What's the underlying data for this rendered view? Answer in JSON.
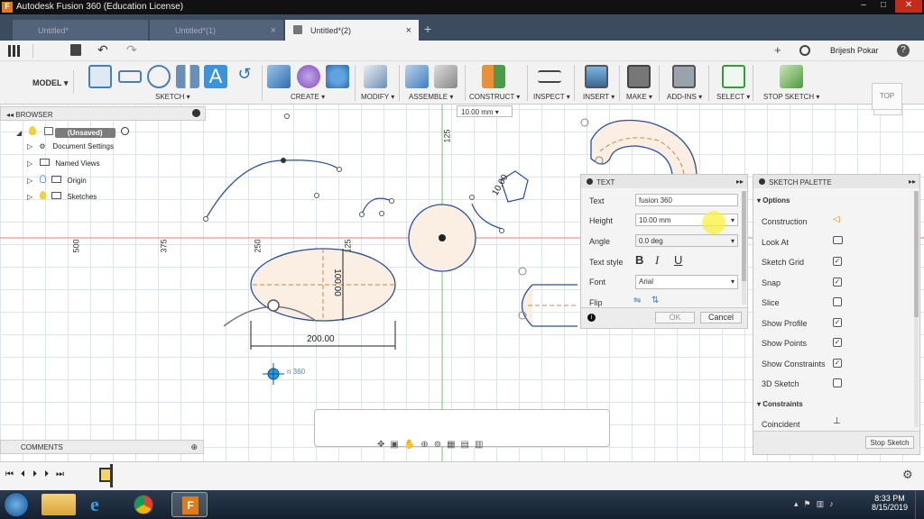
{
  "window": {
    "title": "Autodesk Fusion 360 (Education License)",
    "min": "–",
    "max": "□",
    "close": "✕"
  },
  "tabs": [
    {
      "label": "Untitled*"
    },
    {
      "label": "Untitled*(1)"
    },
    {
      "label": "Untitled*(2)"
    }
  ],
  "tab_close": "×",
  "tab_add": "+",
  "user": {
    "name": "Brijesh Pokar",
    "help": "?"
  },
  "workspace": "MODEL",
  "ribbon": {
    "sketch": "SKETCH",
    "create": "CREATE",
    "modify": "MODIFY",
    "assemble": "ASSEMBLE",
    "construct": "CONSTRUCT",
    "inspect": "INSPECT",
    "insert": "INSERT",
    "make": "MAKE",
    "addins": "ADD-INS",
    "select": "SELECT",
    "stop": "STOP SKETCH"
  },
  "viewcube": {
    "label": "TOP"
  },
  "browser": {
    "title": "BROWSER",
    "root": "(Unsaved)",
    "items": [
      "Document Settings",
      "Named Views",
      "Origin",
      "Sketches"
    ]
  },
  "comments": {
    "title": "COMMENTS"
  },
  "height_input": "10.00 mm",
  "ruler": {
    "h": [
      "500",
      "375",
      "250",
      "125"
    ],
    "v": "125"
  },
  "dims": {
    "width": "200.00",
    "height": "100.00",
    "angled": "10.00",
    "text_preview": "n 360"
  },
  "text_dialog": {
    "title": "TEXT",
    "text_label": "Text",
    "text_value": "fusion 360",
    "height_label": "Height",
    "height_value": "10.00 mm",
    "angle_label": "Angle",
    "angle_value": "0.0 deg",
    "style_label": "Text style",
    "bold": "B",
    "italic": "I",
    "underline": "U",
    "font_label": "Font",
    "font_value": "Arial",
    "flip_label": "Flip",
    "ok": "OK",
    "cancel": "Cancel"
  },
  "palette": {
    "title": "SKETCH PALETTE",
    "options": "Options",
    "rows": [
      {
        "label": "Construction"
      },
      {
        "label": "Look At"
      },
      {
        "label": "Sketch Grid",
        "checked": true
      },
      {
        "label": "Snap",
        "checked": true
      },
      {
        "label": "Slice",
        "checked": false
      },
      {
        "label": "Show Profile",
        "checked": true
      },
      {
        "label": "Show Points",
        "checked": true
      },
      {
        "label": "Show Constraints",
        "checked": true
      },
      {
        "label": "3D Sketch",
        "checked": false
      }
    ],
    "constraints": "Constraints",
    "coincident": "Coincident",
    "stop": "Stop Sketch"
  },
  "clock": {
    "time": "8:33 PM",
    "date": "8/15/2019"
  }
}
